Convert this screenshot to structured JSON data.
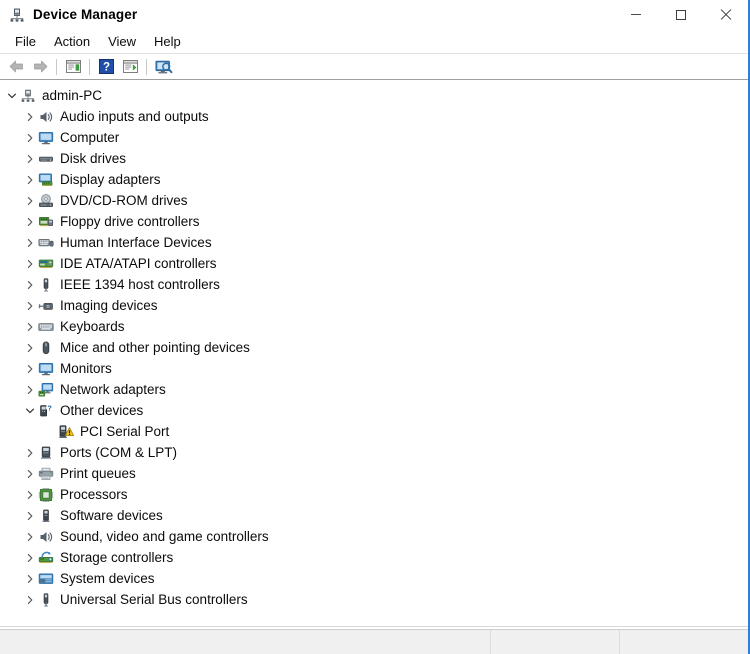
{
  "window": {
    "title": "Device Manager",
    "app_icon": "device-manager-icon",
    "accent_color": "#2f7fd1",
    "controls": [
      {
        "name": "minimize",
        "label": "Minimize",
        "glyph": "minimize-icon"
      },
      {
        "name": "maximize",
        "label": "Maximize",
        "glyph": "maximize-icon"
      },
      {
        "name": "close",
        "label": "Close",
        "glyph": "close-icon"
      }
    ]
  },
  "menubar": {
    "items": [
      {
        "label": "File"
      },
      {
        "label": "Action"
      },
      {
        "label": "View"
      },
      {
        "label": "Help"
      }
    ]
  },
  "toolbar": {
    "items": [
      {
        "name": "back-button",
        "icon": "back-arrow-icon",
        "enabled": false
      },
      {
        "name": "forward-button",
        "icon": "forward-arrow-icon",
        "enabled": false
      },
      {
        "name": "separator-1",
        "icon": "separator",
        "enabled": false
      },
      {
        "name": "properties-button",
        "icon": "properties-icon",
        "enabled": true
      },
      {
        "name": "separator-2",
        "icon": "separator",
        "enabled": false
      },
      {
        "name": "help-button",
        "icon": "help-question-icon",
        "enabled": true
      },
      {
        "name": "update-driver-button",
        "icon": "update-driver-icon",
        "enabled": true
      },
      {
        "name": "separator-3",
        "icon": "separator",
        "enabled": false
      },
      {
        "name": "scan-hardware-button",
        "icon": "scan-hardware-changes-icon",
        "enabled": true
      }
    ]
  },
  "tree": {
    "root": {
      "label": "admin-PC",
      "icon": "computer-root-icon",
      "expanded": true,
      "level": 0
    },
    "nodes": [
      {
        "label": "Audio inputs and outputs",
        "icon": "speaker-icon",
        "expanded": false,
        "level": 1,
        "has_children": true
      },
      {
        "label": "Computer",
        "icon": "monitor-icon",
        "expanded": false,
        "level": 1,
        "has_children": true
      },
      {
        "label": "Disk drives",
        "icon": "disk-drive-icon",
        "expanded": false,
        "level": 1,
        "has_children": true
      },
      {
        "label": "Display adapters",
        "icon": "display-adapter-icon",
        "expanded": false,
        "level": 1,
        "has_children": true
      },
      {
        "label": "DVD/CD-ROM drives",
        "icon": "optical-drive-icon",
        "expanded": false,
        "level": 1,
        "has_children": true
      },
      {
        "label": "Floppy drive controllers",
        "icon": "floppy-controller-icon",
        "expanded": false,
        "level": 1,
        "has_children": true
      },
      {
        "label": "Human Interface Devices",
        "icon": "hid-icon",
        "expanded": false,
        "level": 1,
        "has_children": true
      },
      {
        "label": "IDE ATA/ATAPI controllers",
        "icon": "ide-controller-icon",
        "expanded": false,
        "level": 1,
        "has_children": true
      },
      {
        "label": "IEEE 1394 host controllers",
        "icon": "firewire-icon",
        "expanded": false,
        "level": 1,
        "has_children": true
      },
      {
        "label": "Imaging devices",
        "icon": "camera-icon",
        "expanded": false,
        "level": 1,
        "has_children": true
      },
      {
        "label": "Keyboards",
        "icon": "keyboard-icon",
        "expanded": false,
        "level": 1,
        "has_children": true
      },
      {
        "label": "Mice and other pointing devices",
        "icon": "mouse-icon",
        "expanded": false,
        "level": 1,
        "has_children": true
      },
      {
        "label": "Monitors",
        "icon": "monitor-icon",
        "expanded": false,
        "level": 1,
        "has_children": true
      },
      {
        "label": "Network adapters",
        "icon": "network-adapter-icon",
        "expanded": false,
        "level": 1,
        "has_children": true
      },
      {
        "label": "Other devices",
        "icon": "other-devices-icon",
        "expanded": true,
        "level": 1,
        "has_children": true
      },
      {
        "label": "PCI Serial Port",
        "icon": "unknown-device-warning-icon",
        "expanded": false,
        "level": 2,
        "has_children": false,
        "warning": true
      },
      {
        "label": "Ports (COM & LPT)",
        "icon": "port-icon",
        "expanded": false,
        "level": 1,
        "has_children": true
      },
      {
        "label": "Print queues",
        "icon": "printer-icon",
        "expanded": false,
        "level": 1,
        "has_children": true
      },
      {
        "label": "Processors",
        "icon": "processor-icon",
        "expanded": false,
        "level": 1,
        "has_children": true
      },
      {
        "label": "Software devices",
        "icon": "software-device-icon",
        "expanded": false,
        "level": 1,
        "has_children": true
      },
      {
        "label": "Sound, video and game controllers",
        "icon": "speaker-icon",
        "expanded": false,
        "level": 1,
        "has_children": true
      },
      {
        "label": "Storage controllers",
        "icon": "storage-controller-icon",
        "expanded": false,
        "level": 1,
        "has_children": true
      },
      {
        "label": "System devices",
        "icon": "system-device-icon",
        "expanded": false,
        "level": 1,
        "has_children": true
      },
      {
        "label": "Universal Serial Bus controllers",
        "icon": "usb-controller-icon",
        "expanded": false,
        "level": 1,
        "has_children": true
      }
    ]
  },
  "statusbar": {
    "text": "",
    "panes": [
      "",
      "",
      ""
    ]
  }
}
